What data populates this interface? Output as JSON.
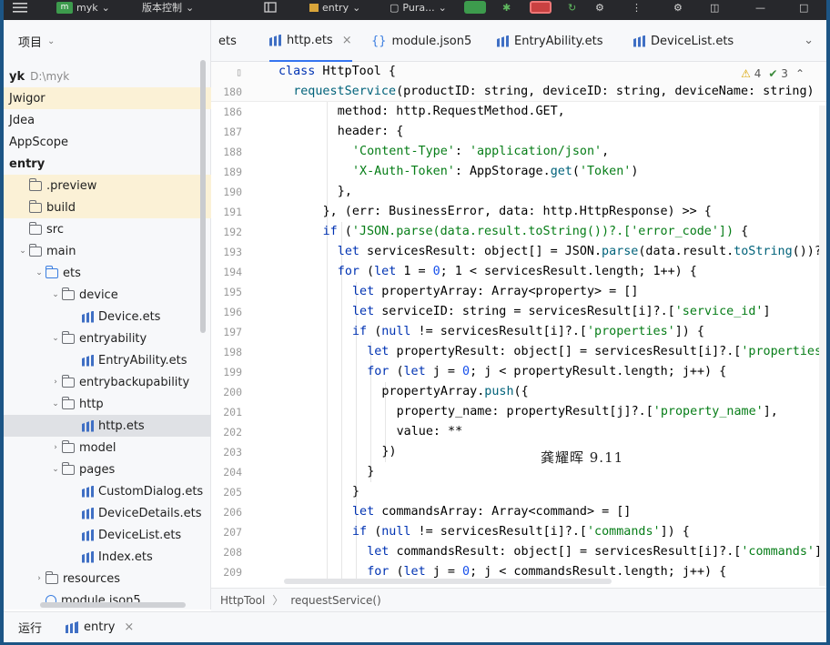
{
  "topbar": {
    "project_name": "myk",
    "project_badge": "m",
    "vcs_label": "版本控制",
    "run_config": "entry",
    "device": "Pura..."
  },
  "project_panel": {
    "title": "项目",
    "items": [
      {
        "label": "yk",
        "extra": "D:\\myk",
        "depth": 0,
        "kind": "root"
      },
      {
        "label": "Jwigor",
        "depth": 0,
        "kind": "plain",
        "highlight": "hl"
      },
      {
        "label": "Jdea",
        "depth": 0,
        "kind": "plain"
      },
      {
        "label": "AppScope",
        "depth": 0,
        "kind": "plain"
      },
      {
        "label": "entry",
        "depth": 0,
        "kind": "bold"
      },
      {
        "label": ".preview",
        "depth": 1,
        "kind": "folder",
        "highlight": "hl"
      },
      {
        "label": "build",
        "depth": 1,
        "kind": "folder",
        "highlight": "hl"
      },
      {
        "label": "src",
        "depth": 1,
        "kind": "folder"
      },
      {
        "label": "main",
        "depth": 1,
        "kind": "folder",
        "arrow": "open"
      },
      {
        "label": "ets",
        "depth": 2,
        "kind": "folder-blue",
        "arrow": "open"
      },
      {
        "label": "device",
        "depth": 3,
        "kind": "folder",
        "arrow": "open"
      },
      {
        "label": "Device.ets",
        "depth": 5,
        "kind": "ets"
      },
      {
        "label": "entryability",
        "depth": 3,
        "kind": "folder",
        "arrow": "open"
      },
      {
        "label": "EntryAbility.ets",
        "depth": 5,
        "kind": "ets"
      },
      {
        "label": "entrybackupability",
        "depth": 3,
        "kind": "folder",
        "arrow": "closed"
      },
      {
        "label": "http",
        "depth": 3,
        "kind": "folder",
        "arrow": "open"
      },
      {
        "label": "http.ets",
        "depth": 5,
        "kind": "ets",
        "highlight": "sel"
      },
      {
        "label": "model",
        "depth": 3,
        "kind": "folder",
        "arrow": "closed"
      },
      {
        "label": "pages",
        "depth": 3,
        "kind": "folder",
        "arrow": "open"
      },
      {
        "label": "CustomDialog.ets",
        "depth": 5,
        "kind": "ets"
      },
      {
        "label": "DeviceDetails.ets",
        "depth": 5,
        "kind": "ets"
      },
      {
        "label": "DeviceList.ets",
        "depth": 5,
        "kind": "ets"
      },
      {
        "label": "Index.ets",
        "depth": 5,
        "kind": "ets"
      },
      {
        "label": "resources",
        "depth": 2,
        "kind": "folder",
        "arrow": "closed"
      },
      {
        "label": "module.json5",
        "depth": 2,
        "kind": "json"
      }
    ]
  },
  "tabs": [
    {
      "label": "ets",
      "icon": "none"
    },
    {
      "label": "http.ets",
      "icon": "ets",
      "active": true,
      "close": "×"
    },
    {
      "label": "module.json5",
      "icon": "json"
    },
    {
      "label": "EntryAbility.ets",
      "icon": "ets"
    },
    {
      "label": "DeviceList.ets",
      "icon": "ets"
    }
  ],
  "tab_overflow": "ets-icon",
  "tab_menu": "⌄",
  "editor": {
    "inspections": {
      "warnings": "4",
      "ok": "3"
    },
    "sticky_lines": [
      {
        "num": "",
        "indent": 0,
        "tokens": [
          [
            "kw",
            "class "
          ],
          [
            "cls",
            "HttpTool {"
          ]
        ]
      },
      {
        "num": "180",
        "indent": 1,
        "tokens": [
          [
            "fn",
            "requestService"
          ],
          [
            "cls",
            "(productID: string, deviceID: string, deviceName: string)"
          ]
        ]
      }
    ],
    "lines": [
      {
        "num": "186",
        "indent": 4,
        "tokens": [
          [
            "cls",
            "method: http.RequestMethod.GET,"
          ]
        ]
      },
      {
        "num": "187",
        "indent": 4,
        "tokens": [
          [
            "cls",
            "header: {"
          ]
        ]
      },
      {
        "num": "188",
        "indent": 5,
        "tokens": [
          [
            "str",
            "'Content-Type'"
          ],
          [
            "cls",
            ": "
          ],
          [
            "str",
            "'application/json'"
          ],
          [
            "cls",
            ","
          ]
        ]
      },
      {
        "num": "189",
        "indent": 5,
        "tokens": [
          [
            "str",
            "'X-Auth-Token'"
          ],
          [
            "cls",
            ": AppStorage."
          ],
          [
            "fn",
            "get"
          ],
          [
            "cls",
            "("
          ],
          [
            "str",
            "'Token'"
          ],
          [
            "cls",
            ")"
          ]
        ]
      },
      {
        "num": "190",
        "indent": 4,
        "tokens": [
          [
            "cls",
            "},"
          ]
        ]
      },
      {
        "num": "191",
        "indent": 3,
        "tokens": [
          [
            "cls",
            "}, (err: BusinessError, data: http.HttpResponse) >> {"
          ]
        ]
      },
      {
        "num": "192",
        "indent": 3,
        "tokens": [
          [
            "kw",
            "if "
          ],
          [
            "cls",
            "("
          ],
          [
            "str",
            "'JSON.parse(data.result.toString())?.['error_code'])"
          ],
          [
            "cls",
            " {"
          ]
        ]
      },
      {
        "num": "193",
        "indent": 4,
        "tokens": [
          [
            "kw",
            "let "
          ],
          [
            "cls",
            "servicesResult: object[] = JSON."
          ],
          [
            "fn",
            "parse"
          ],
          [
            "cls",
            "(data.result."
          ],
          [
            "fn",
            "toString"
          ],
          [
            "cls",
            "())?."
          ]
        ]
      },
      {
        "num": "194",
        "indent": 4,
        "tokens": [
          [
            "kw",
            "for "
          ],
          [
            "cls",
            "("
          ],
          [
            "kw",
            "let "
          ],
          [
            "cls",
            "1 = "
          ],
          [
            "num",
            "0"
          ],
          [
            "cls",
            "; 1 < servicesResult.length; 1++) {"
          ]
        ]
      },
      {
        "num": "195",
        "indent": 5,
        "tokens": [
          [
            "kw",
            "let "
          ],
          [
            "cls",
            "propertyArray: Array<property> = []"
          ]
        ]
      },
      {
        "num": "196",
        "indent": 5,
        "tokens": [
          [
            "kw",
            "let "
          ],
          [
            "cls",
            "serviceID: string = servicesResult[i]?.["
          ],
          [
            "str",
            "'service_id'"
          ],
          [
            "cls",
            "]"
          ]
        ]
      },
      {
        "num": "197",
        "indent": 5,
        "tokens": [
          [
            "kw",
            "if "
          ],
          [
            "cls",
            "("
          ],
          [
            "kw",
            "null"
          ],
          [
            "cls",
            " != servicesResult[i]?.["
          ],
          [
            "str",
            "'properties'"
          ],
          [
            "cls",
            "]) {"
          ]
        ]
      },
      {
        "num": "198",
        "indent": 6,
        "tokens": [
          [
            "kw",
            "let "
          ],
          [
            "cls",
            "propertyResult: object[] = servicesResult[i]?.["
          ],
          [
            "str",
            "'properties'"
          ]
        ]
      },
      {
        "num": "199",
        "indent": 6,
        "tokens": [
          [
            "kw",
            "for "
          ],
          [
            "cls",
            "("
          ],
          [
            "kw",
            "let "
          ],
          [
            "cls",
            "j = "
          ],
          [
            "num",
            "0"
          ],
          [
            "cls",
            "; j < propertyResult.length; j++) {"
          ]
        ]
      },
      {
        "num": "200",
        "indent": 7,
        "tokens": [
          [
            "cls",
            "propertyArray."
          ],
          [
            "fn",
            "push"
          ],
          [
            "cls",
            "({"
          ]
        ]
      },
      {
        "num": "201",
        "indent": 8,
        "tokens": [
          [
            "cls",
            "property_name: propertyResult[j]?.["
          ],
          [
            "str",
            "'property_name'"
          ],
          [
            "cls",
            "],"
          ]
        ]
      },
      {
        "num": "202",
        "indent": 8,
        "tokens": [
          [
            "cls",
            "value: **"
          ]
        ]
      },
      {
        "num": "203",
        "indent": 7,
        "tokens": [
          [
            "cls",
            "})"
          ]
        ]
      },
      {
        "num": "204",
        "indent": 6,
        "tokens": [
          [
            "cls",
            "}"
          ]
        ]
      },
      {
        "num": "205",
        "indent": 5,
        "tokens": [
          [
            "cls",
            "}"
          ]
        ]
      },
      {
        "num": "206",
        "indent": 5,
        "tokens": [
          [
            "kw",
            "let "
          ],
          [
            "cls",
            "commandsArray: Array<command> = []"
          ]
        ]
      },
      {
        "num": "207",
        "indent": 5,
        "tokens": [
          [
            "kw",
            "if "
          ],
          [
            "cls",
            "("
          ],
          [
            "kw",
            "null"
          ],
          [
            "cls",
            " != servicesResult[i]?.["
          ],
          [
            "str",
            "'commands'"
          ],
          [
            "cls",
            "]) {"
          ]
        ]
      },
      {
        "num": "208",
        "indent": 6,
        "tokens": [
          [
            "kw",
            "let "
          ],
          [
            "cls",
            "commandsResult: object[] = servicesResult[i]?.["
          ],
          [
            "str",
            "'commands'"
          ],
          [
            "cls",
            "]"
          ]
        ]
      },
      {
        "num": "209",
        "indent": 6,
        "tokens": [
          [
            "kw",
            "for "
          ],
          [
            "cls",
            "("
          ],
          [
            "kw",
            "let "
          ],
          [
            "cls",
            "j = "
          ],
          [
            "num",
            "0"
          ],
          [
            "cls",
            "; j < commandsResult.length; j++) {"
          ]
        ]
      }
    ],
    "watermark": "龚耀晖 9.11"
  },
  "breadcrumb": {
    "class": "HttpTool",
    "method": "requestService()",
    "sep": "〉"
  },
  "runbar": {
    "label": "运行",
    "tab": "entry",
    "close": "×"
  }
}
